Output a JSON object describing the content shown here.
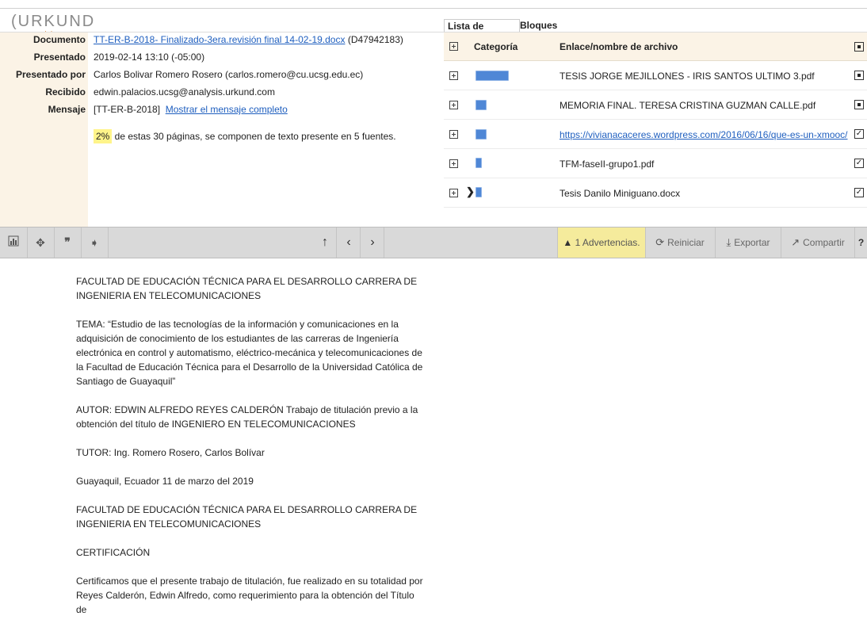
{
  "app": {
    "logo": "URKUND"
  },
  "meta": {
    "rows": [
      {
        "label": "Documento",
        "value": "TT-ER-B-2018- Finalizado-3era.revisión final 14-02-19.docx",
        "extra": " (D47942183)"
      },
      {
        "label": "Presentado",
        "value": "2019-02-14 13:10 (-05:00)"
      },
      {
        "label": "Presentado por",
        "value": "Carlos Bolivar Romero Rosero (carlos.romero@cu.ucsg.edu.ec)"
      },
      {
        "label": "Recibido",
        "value": "edwin.palacios.ucsg@analysis.urkund.com"
      },
      {
        "label": "Mensaje",
        "value": "[TT-ER-B-2018]",
        "link": "Mostrar el mensaje completo"
      }
    ],
    "percent": "2%",
    "summary": " de estas 30 páginas, se componen de texto presente en 5 fuentes."
  },
  "sources": {
    "tabs": [
      "Lista de fuentes",
      "Bloques"
    ],
    "col_category": "Categoría",
    "col_name": "Enlace/nombre de archivo",
    "rows": [
      {
        "name": "TESIS JORGE MEJILLONES - IRIS SANTOS ULTIMO 3.pdf",
        "bar_fraction": 1.0,
        "is_link": false,
        "checked": false
      },
      {
        "name": "MEMORIA FINAL. TERESA CRISTINA GUZMAN CALLE.pdf",
        "bar_fraction": 0.3,
        "is_link": false,
        "checked": false
      },
      {
        "name": "https://vivianacaceres.wordpress.com/2016/06/16/que-es-un-xmooc/",
        "bar_fraction": 0.3,
        "is_link": true,
        "checked": true
      },
      {
        "name": "TFM-faseII-grupo1.pdf",
        "bar_fraction": 0.15,
        "is_link": false,
        "checked": true
      },
      {
        "name": "Tesis Danilo Miniguano.docx",
        "bar_fraction": 0.15,
        "is_link": false,
        "checked": true
      }
    ],
    "active_marker": "❯"
  },
  "toolbar": {
    "warnings": "1 Advertencias.",
    "restart": "Reiniciar",
    "export": "Exportar",
    "share": "Compartir"
  },
  "document": {
    "paragraphs": [
      "FACULTAD DE EDUCACIÓN TÉCNICA PARA EL DESARROLLO CARRERA DE INGENIERIA EN TELECOMUNICACIONES",
      "TEMA: “Estudio de las tecnologías de la información y comunicaciones en la adquisición de conocimiento de los estudiantes de las carreras de Ingeniería electrónica en control y automatismo, eléctrico-mecánica y telecomunicaciones de la Facultad de Educación Técnica para el Desarrollo de la Universidad Católica de Santiago de Guayaquil”",
      "AUTOR: EDWIN ALFREDO REYES CALDERÓN Trabajo de titulación previo a la obtención del título de INGENIERO EN TELECOMUNICACIONES",
      "TUTOR: Ing. Romero Rosero, Carlos Bolívar",
      "Guayaquil, Ecuador 11 de marzo del 2019",
      "FACULTAD DE EDUCACIÓN TÉCNICA PARA EL DESARROLLO CARRERA DE INGENIERIA EN TELECOMUNICACIONES",
      "CERTIFICACIÓN",
      "Certificamos que el presente trabajo de titulación, fue realizado en su totalidad por Reyes Calderón, Edwin Alfredo, como requerimiento para la obtención del Título de"
    ]
  }
}
